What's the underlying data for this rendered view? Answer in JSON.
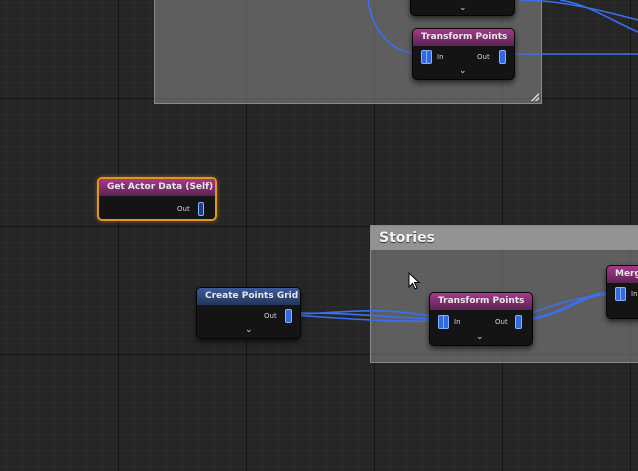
{
  "comments": {
    "top_group": {
      "title": ""
    },
    "stories": {
      "title": "Stories"
    }
  },
  "nodes": {
    "transform_points_top": {
      "title": "Transform Points",
      "in_label": "In",
      "out_label": "Out"
    },
    "get_actor_data": {
      "title": "Get Actor Data (Self)",
      "out_label": "Out"
    },
    "create_points_grid": {
      "title": "Create Points Grid",
      "out_label": "Out"
    },
    "transform_points_stories": {
      "title": "Transform Points",
      "in_label": "In",
      "out_label": "Out"
    },
    "merge_partial": {
      "title": "Merge",
      "in_label": "In"
    }
  },
  "colors": {
    "wire": "#3a6ff0",
    "pin": "#2f6ae0",
    "header_sampler": "#a53a8d",
    "header_spatial": "#3c5a9c",
    "selection": "#e5951c"
  },
  "icons": {
    "collapse": "chevron-down-icon",
    "resize": "resize-grip-icon",
    "cursor": "mouse-pointer-icon"
  }
}
